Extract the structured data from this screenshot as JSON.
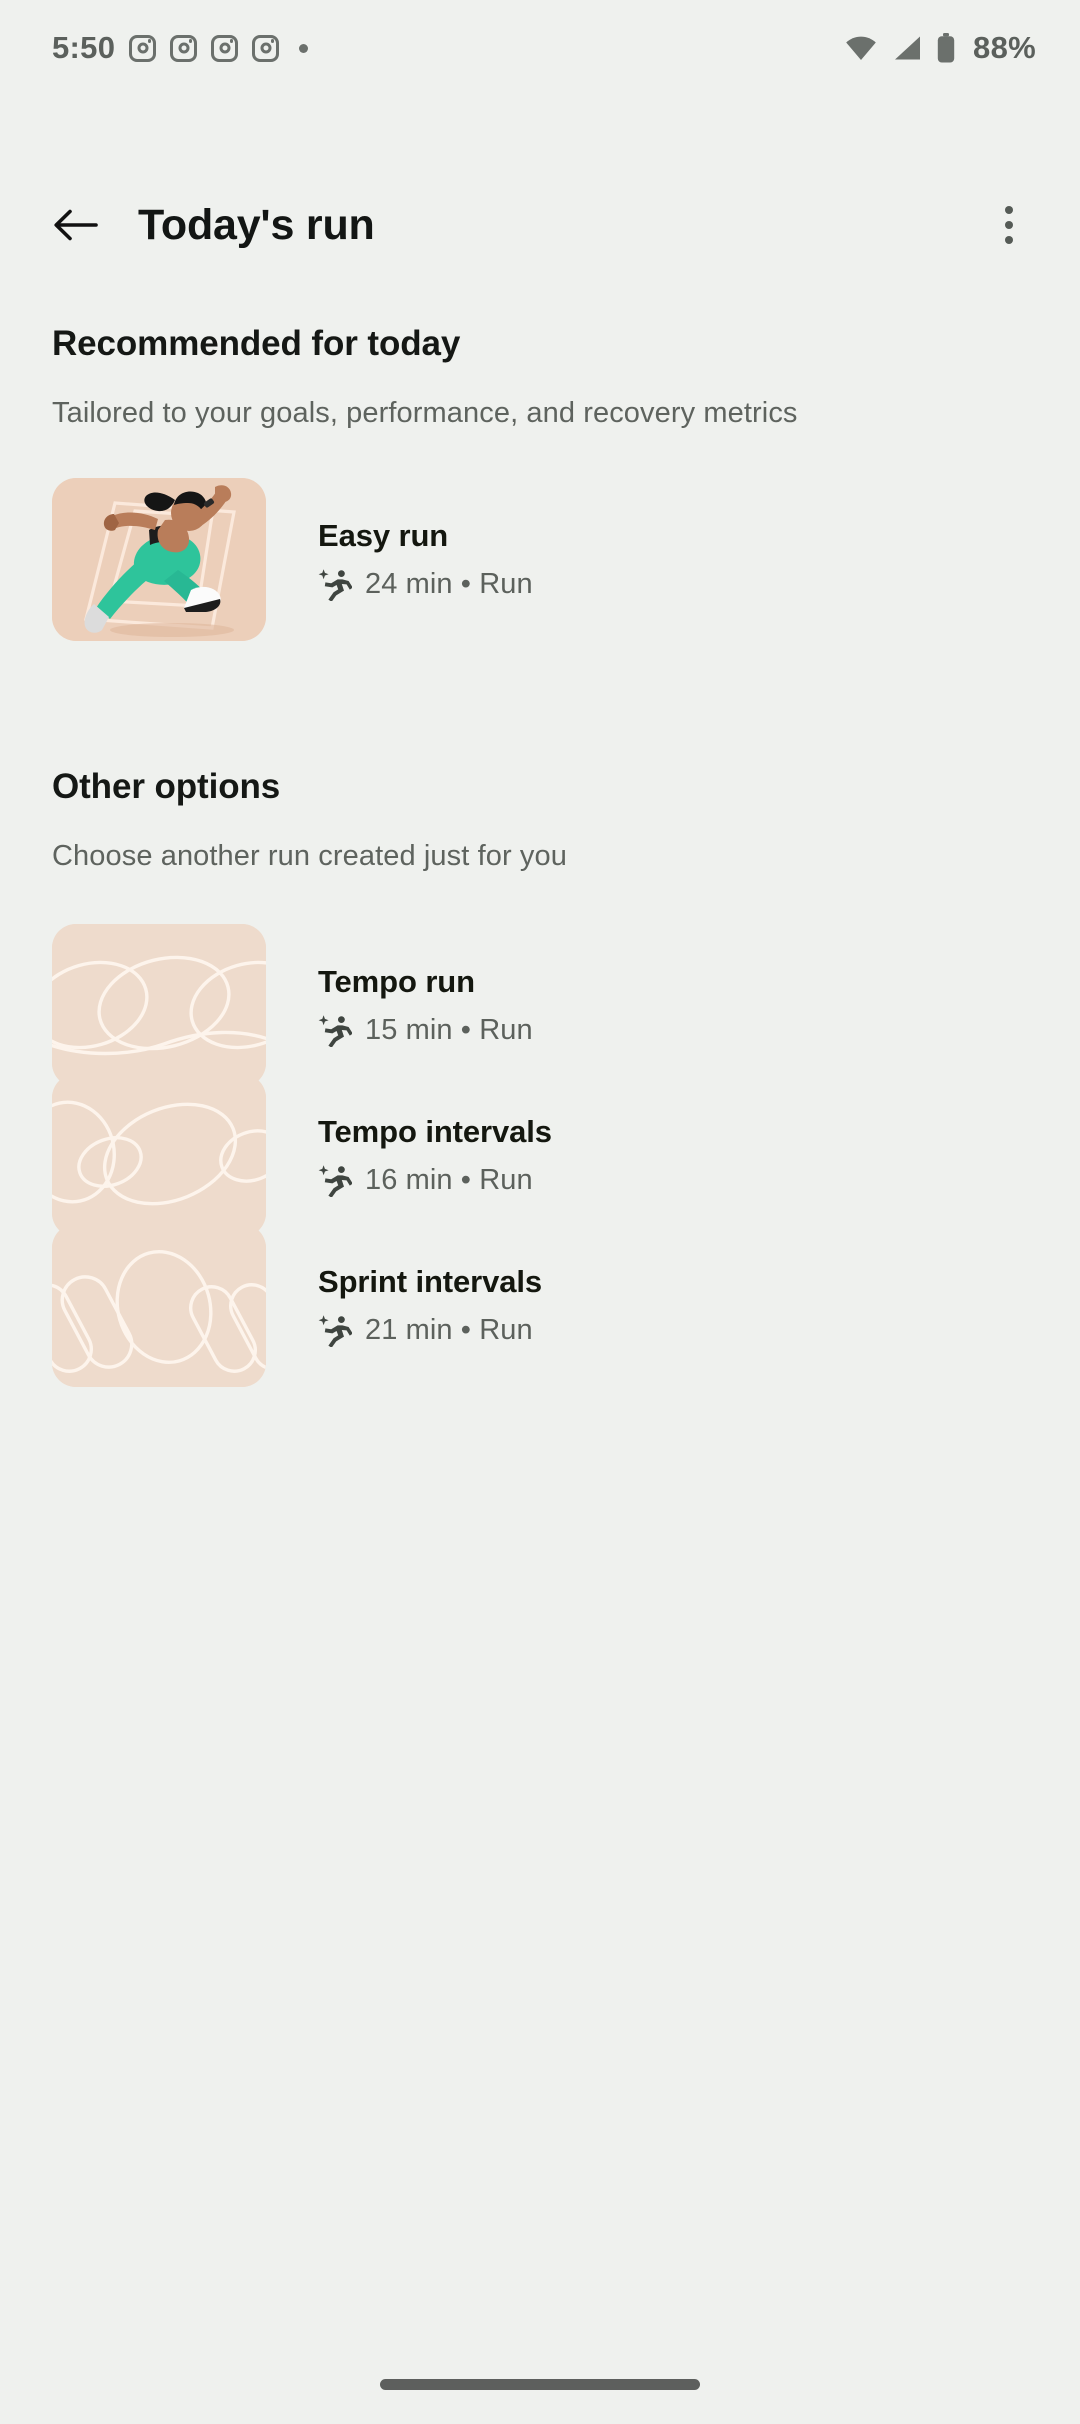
{
  "status_bar": {
    "time": "5:50",
    "battery_percent": "88%",
    "notification_icons": [
      "instagram-icon",
      "instagram-icon",
      "instagram-icon",
      "instagram-icon",
      "overflow-dot-icon"
    ],
    "right_icons": [
      "wifi-icon",
      "cellular-signal-icon",
      "battery-icon"
    ]
  },
  "app_bar": {
    "back_icon": "back-arrow-icon",
    "title": "Today's run",
    "overflow_icon": "more-vert-icon"
  },
  "recommended": {
    "heading": "Recommended for today",
    "subheading": "Tailored to your goals, performance, and recovery metrics",
    "card": {
      "title": "Easy run",
      "meta": "24 min • Run",
      "duration": "24 min",
      "activity": "Run",
      "icon": "ai-run-sparkle-icon",
      "thumbnail": "runner-illustration"
    }
  },
  "other_options": {
    "heading": "Other options",
    "subheading": "Choose another run created just for you",
    "cards": [
      {
        "title": "Tempo run",
        "meta": "15 min • Run",
        "duration": "15 min",
        "activity": "Run",
        "icon": "ai-run-sparkle-icon",
        "thumbnail": "loop-pattern-wide-ellipses"
      },
      {
        "title": "Tempo intervals",
        "meta": "16 min • Run",
        "duration": "16 min",
        "activity": "Run",
        "icon": "ai-run-sparkle-icon",
        "thumbnail": "loop-pattern-mixed-ellipses"
      },
      {
        "title": "Sprint intervals",
        "meta": "21 min • Run",
        "duration": "21 min",
        "activity": "Run",
        "icon": "ai-run-sparkle-icon",
        "thumbnail": "loop-pattern-tilted-capsules"
      }
    ]
  },
  "nav_bar": {
    "handle": "gesture-nav-handle"
  },
  "colors": {
    "background": "#eff1ee",
    "thumbnail_peach": "#eedbcc",
    "thumbnail_line": "#fdf4ec",
    "text_primary": "#14170f",
    "text_secondary": "#5c615c",
    "accent_teal": "#20c49a",
    "skin": "#b97d5a",
    "hair": "#181818"
  }
}
